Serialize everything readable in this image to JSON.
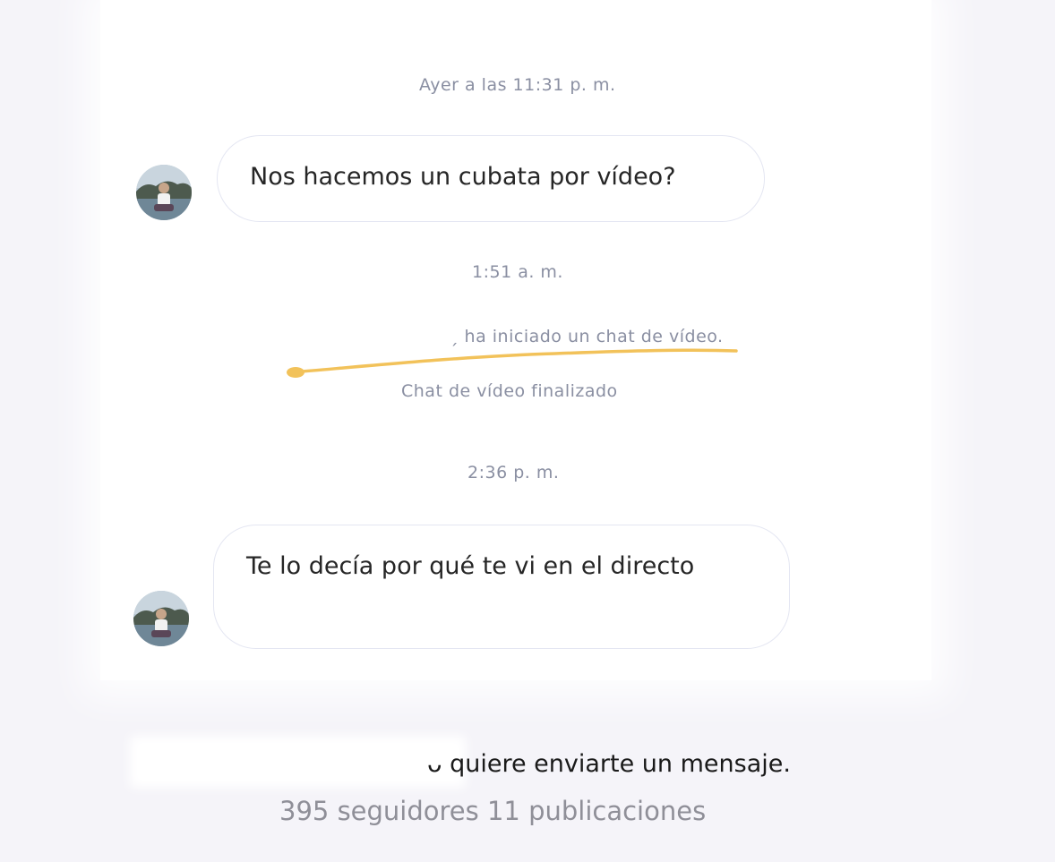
{
  "conversation": {
    "timestamps": {
      "first": "Ayer a las 11:31 p. m.",
      "second": "1:51 a. m.",
      "third": "2:36 p. m."
    },
    "messages": [
      {
        "text": "Nos hacemos un cubata por vídeo?"
      },
      {
        "text": "Te lo decía por qué te vi en el directo"
      }
    ],
    "system_events": {
      "video_started": "ha iniciado un chat de vídeo.",
      "video_ended": "Chat de vídeo finalizado"
    }
  },
  "footer": {
    "request_text": "quiere enviarte un mensaje.",
    "stats_text": "395 seguidores 11 publicaciones"
  },
  "colors": {
    "annotation": "#f2c25a",
    "muted_text": "#8a8fa2",
    "bubble_border": "#e4e6f2"
  }
}
